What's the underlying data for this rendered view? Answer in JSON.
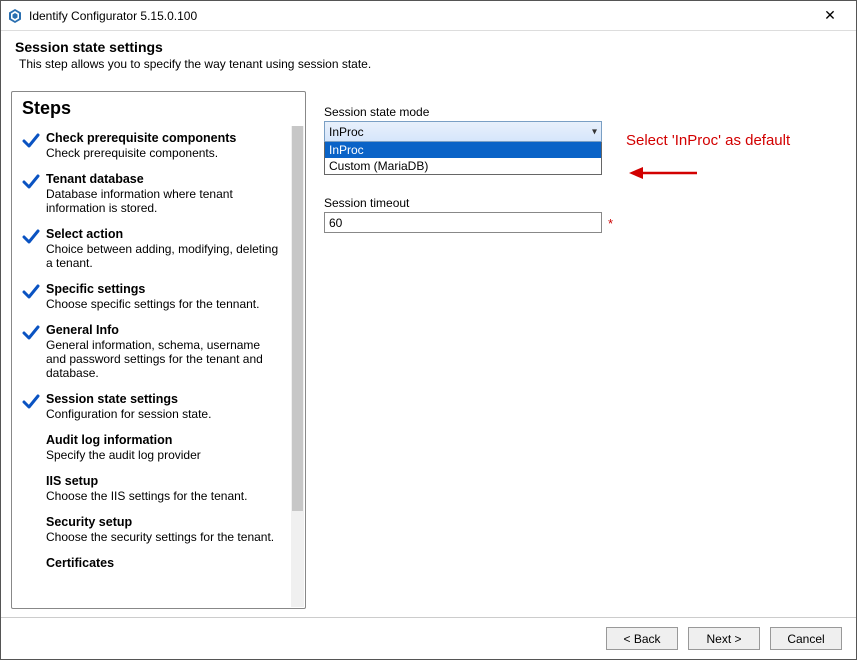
{
  "titlebar": {
    "title": "Identify Configurator 5.15.0.100"
  },
  "header": {
    "title": "Session state settings",
    "subtitle": "This step allows you to specify the way tenant using session state."
  },
  "steps_heading": "Steps",
  "steps": [
    {
      "title": "Check prerequisite components",
      "desc": "Check prerequisite components.",
      "checked": true
    },
    {
      "title": "Tenant database",
      "desc": "Database information where tenant information is stored.",
      "checked": true
    },
    {
      "title": "Select action",
      "desc": "Choice between adding, modifying, deleting a tenant.",
      "checked": true
    },
    {
      "title": "Specific settings",
      "desc": "Choose specific settings for the tennant.",
      "checked": true
    },
    {
      "title": "General Info",
      "desc": "General information, schema, username and password settings for the tenant and database.",
      "checked": true
    },
    {
      "title": "Session state settings",
      "desc": "Configuration for session state.",
      "checked": true
    },
    {
      "title": "Audit log information",
      "desc": "Specify the audit log provider",
      "checked": false
    },
    {
      "title": "IIS setup",
      "desc": "Choose the IIS settings for the tenant.",
      "checked": false
    },
    {
      "title": "Security setup",
      "desc": "Choose the security settings for the tenant.",
      "checked": false
    },
    {
      "title": "Certificates",
      "desc": "",
      "checked": false
    }
  ],
  "form": {
    "mode_label": "Session state mode",
    "mode_value": "InProc",
    "mode_options": [
      "InProc",
      "Custom (MariaDB)"
    ],
    "timeout_label": "Session timeout",
    "timeout_value": "60"
  },
  "annotation": "Select 'InProc' as default",
  "buttons": {
    "back": "< Back",
    "next": "Next >",
    "cancel": "Cancel"
  }
}
